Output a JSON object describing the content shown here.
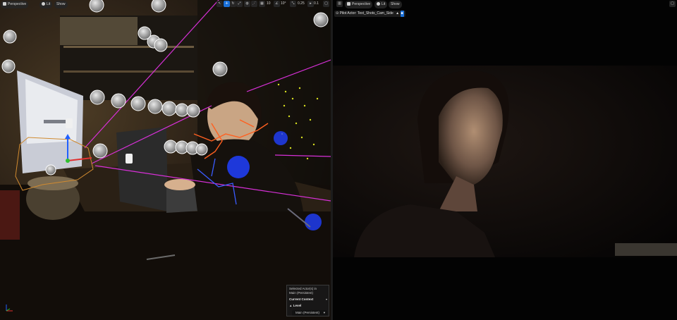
{
  "left_viewport": {
    "toolbar": {
      "view_mode": "Perspective",
      "lit": "Lit",
      "show": "Show",
      "grid_snap": "10",
      "rotation_snap": "10°",
      "scale_snap": "0.25",
      "camera_speed": "0.1"
    },
    "context_panel": {
      "selected_line1": "Selected Actor(s) in",
      "selected_line2": "Main (Persistent)",
      "current_context": "Current Context",
      "level_label": "Level",
      "level_value": "Main (Persistent)"
    }
  },
  "right_viewport": {
    "toolbar": {
      "view_mode": "Perspective",
      "lit": "Lit",
      "show": "Show"
    },
    "pilot": {
      "prefix": "Pilot Actor:",
      "actor": "Test_Shots_Cam_Side"
    }
  },
  "colors": {
    "accent": "#1a70d8",
    "spline": "#d830d8",
    "gizmo_x": "#e03030",
    "gizmo_y": "#30c030",
    "gizmo_z": "#2060ff"
  }
}
